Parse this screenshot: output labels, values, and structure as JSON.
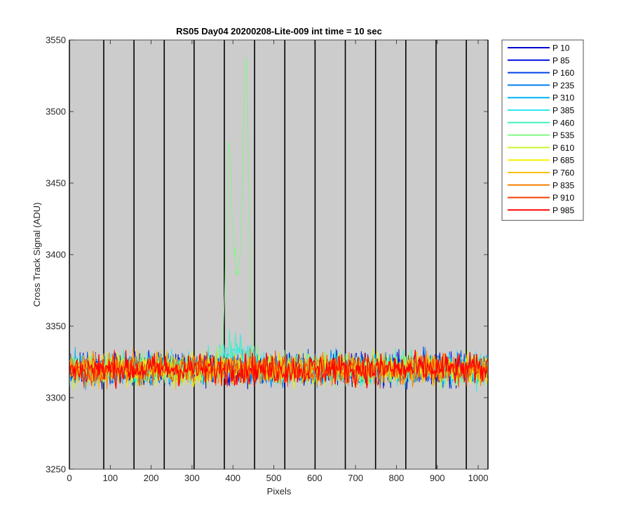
{
  "chart_data": {
    "type": "line",
    "title": "RS05 Day04 20200208-Lite-009 int time = 10 sec",
    "xlabel": "Pixels",
    "ylabel": "Cross Track Signal (ADU)",
    "xlim": [
      0,
      1024
    ],
    "ylim": [
      3250,
      3550
    ],
    "x_ticks": [
      0,
      100,
      200,
      300,
      400,
      500,
      600,
      700,
      800,
      900,
      1000
    ],
    "y_ticks": [
      3250,
      3300,
      3350,
      3400,
      3450,
      3500,
      3550
    ],
    "vertical_lines": [
      0,
      84,
      158,
      232,
      305,
      379,
      453,
      527,
      601,
      675,
      749,
      823,
      897,
      971,
      1024
    ],
    "plot_background": "#cccccc",
    "grid": false,
    "legend_position": "outside-right",
    "baseline_mean": 3320,
    "noise_range": [
      3290,
      3350
    ],
    "series": [
      {
        "name": "P 10",
        "color": "#0000cc"
      },
      {
        "name": "P 85",
        "color": "#0010e0"
      },
      {
        "name": "P 160",
        "color": "#0044e6"
      },
      {
        "name": "P 235",
        "color": "#0080f0"
      },
      {
        "name": "P 310",
        "color": "#00b0f8"
      },
      {
        "name": "P 385",
        "color": "#30e8f0"
      },
      {
        "name": "P 460",
        "color": "#40f0c0"
      },
      {
        "name": "P 535",
        "color": "#80f880",
        "peaks": [
          {
            "x": 390,
            "y": 3460
          },
          {
            "x": 432,
            "y": 3525
          }
        ]
      },
      {
        "name": "P 610",
        "color": "#c8f830"
      },
      {
        "name": "P 685",
        "color": "#f8f000"
      },
      {
        "name": "P 760",
        "color": "#f8c000"
      },
      {
        "name": "P 835",
        "color": "#f88000"
      },
      {
        "name": "P 910",
        "color": "#f84000"
      },
      {
        "name": "P 985",
        "color": "#ff0000"
      }
    ]
  }
}
